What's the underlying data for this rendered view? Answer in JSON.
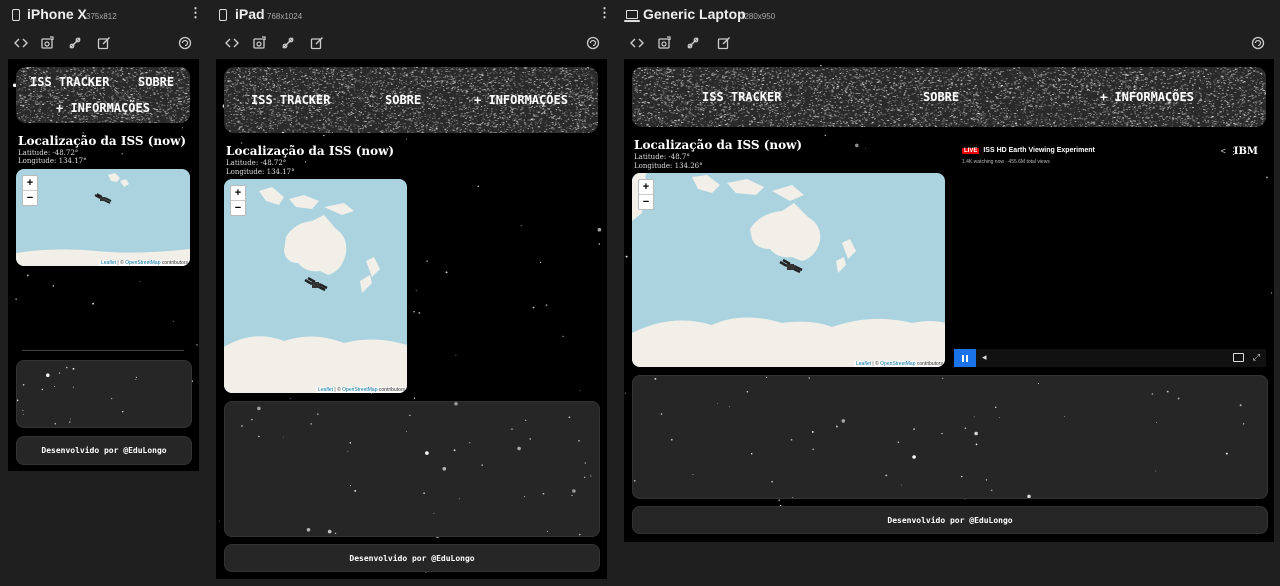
{
  "devices": [
    {
      "name": "iPhone X",
      "size": "375x812"
    },
    {
      "name": "iPad",
      "size": "768x1024"
    },
    {
      "name": "Generic Laptop",
      "size": "1280x950"
    }
  ],
  "toolbar_icons": [
    "code-icon",
    "screenshot-icon",
    "satellite-icon",
    "edit-icon",
    "rotate-icon"
  ],
  "site": {
    "nav": {
      "tracker": "ISS TRACKER",
      "about": "SOBRE",
      "info": "+ INFORMAÇÕES"
    },
    "location_title": "Localização da ISS (now)",
    "zoom_in": "+",
    "zoom_out": "−",
    "attribution_leaflet": "Leaflet",
    "attribution_sep": " | © ",
    "attribution_osm": "OpenStreetMap",
    "attribution_rest": " contributors",
    "footer": "Desenvolvido por @EduLongo"
  },
  "readings": {
    "iphone": {
      "lat": "Latitude: -48.72°",
      "lon": "Longitude: 134.17°"
    },
    "ipad": {
      "lat": "Latitude: -48.72°",
      "lon": "Longitude: 134.17°"
    },
    "laptop": {
      "lat": "Latitude: -48.7°",
      "lon": "Longitude: 134.26°"
    }
  },
  "video": {
    "live": "LIVE",
    "title": "ISS HD Earth Viewing Experiment",
    "stats": "1.4K watching now · 455.6M total views",
    "brand": "IBM"
  },
  "colors": {
    "page_bg": "#1f1f1f",
    "site_bg": "#000000",
    "map_water": "#aad3df",
    "play_button": "#1a73e8",
    "live_badge": "#ee0000"
  }
}
